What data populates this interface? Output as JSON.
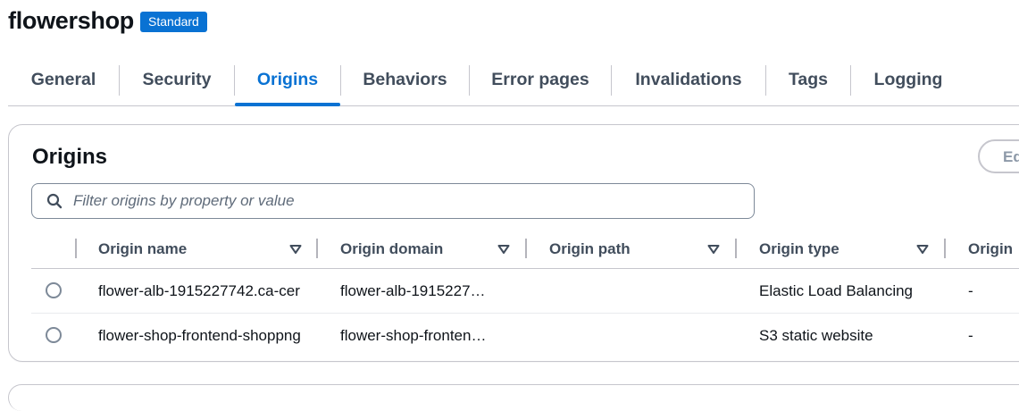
{
  "header": {
    "title": "flowershop",
    "badge": "Standard"
  },
  "tabs": [
    {
      "label": "General"
    },
    {
      "label": "Security"
    },
    {
      "label": "Origins",
      "active": true
    },
    {
      "label": "Behaviors"
    },
    {
      "label": "Error pages"
    },
    {
      "label": "Invalidations"
    },
    {
      "label": "Tags"
    },
    {
      "label": "Logging"
    }
  ],
  "origins_panel": {
    "title": "Origins",
    "edit_label": "Ed",
    "search": {
      "placeholder": "Filter origins by property or value",
      "value": ""
    },
    "columns": [
      "Origin name",
      "Origin domain",
      "Origin path",
      "Origin type",
      "Origin"
    ],
    "rows": [
      {
        "name": "flower-alb-1915227742.ca-cer",
        "domain": "flower-alb-1915227…",
        "path": "",
        "type": "Elastic Load Balancing",
        "extra": "-"
      },
      {
        "name": "flower-shop-frontend-shoppng",
        "domain": "flower-shop-fronten…",
        "path": "",
        "type": "S3 static website",
        "extra": "-"
      }
    ]
  },
  "icons": {
    "search": "search-icon",
    "sort": "caret-down-icon"
  },
  "colors": {
    "accent": "#0972d3",
    "text": "#0f141a",
    "muted": "#414d5c",
    "border": "#c6c6cd"
  }
}
